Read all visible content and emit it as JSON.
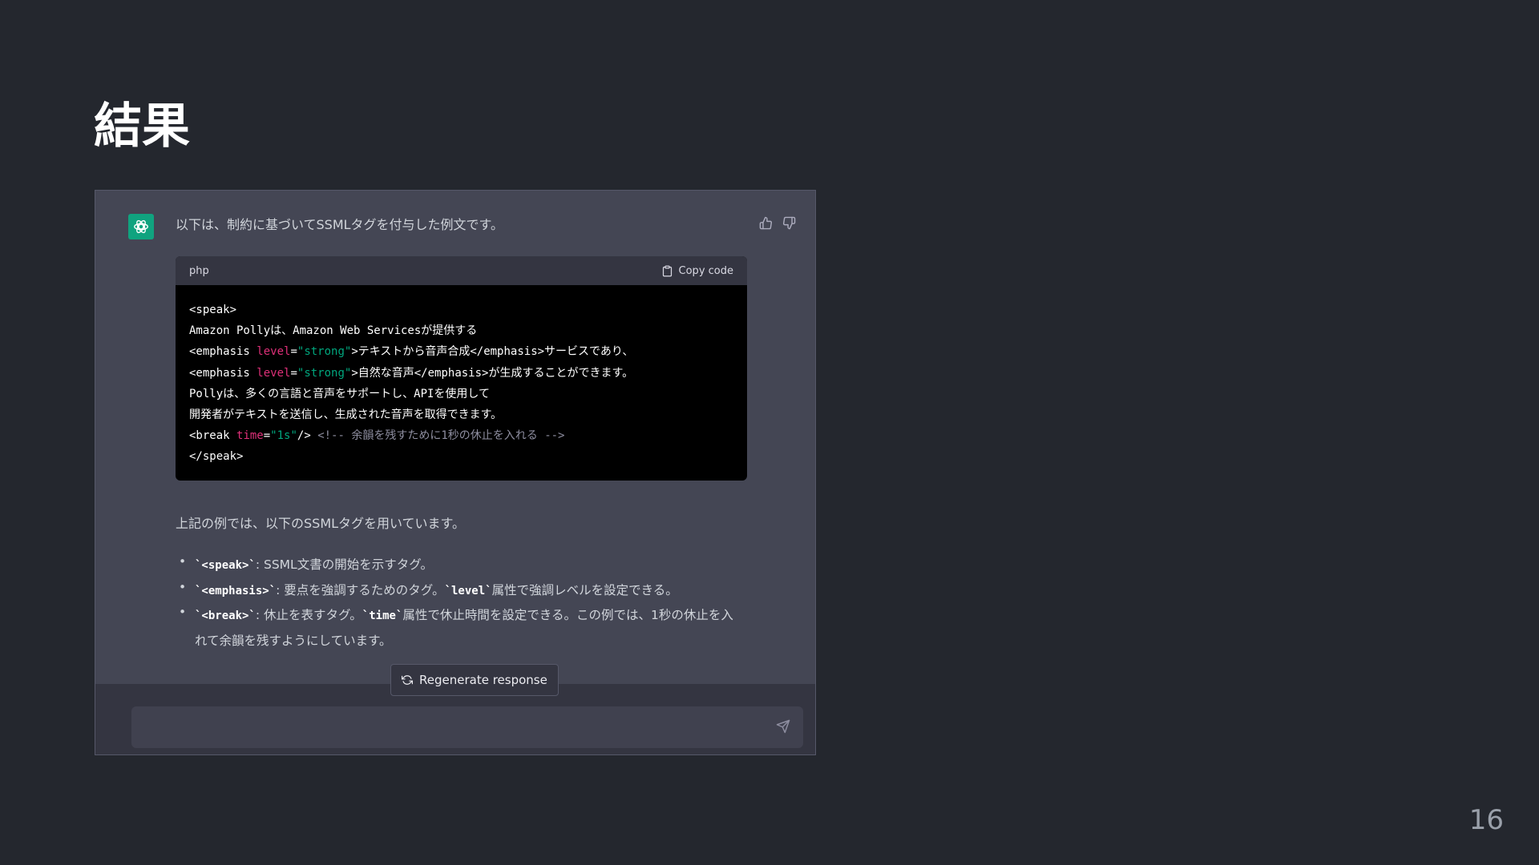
{
  "slide": {
    "title": "結果",
    "page_number": "16"
  },
  "chat": {
    "intro": "以下は、制約に基づいてSSMLタグを付与した例文です。",
    "code_block": {
      "language": "php",
      "copy_label": "Copy code",
      "lines": [
        {
          "text": "<speak>"
        },
        {
          "text": "Amazon Pollyは、Amazon Web Servicesが提供する"
        },
        {
          "pre": "<emphasis ",
          "attr": "level",
          "eq": "=",
          "str": "\"strong\"",
          "post": ">テキストから音声合成</emphasis>サービスであり、"
        },
        {
          "pre": "<emphasis ",
          "attr": "level",
          "eq": "=",
          "str": "\"strong\"",
          "post": ">自然な音声</emphasis>が生成することができます。"
        },
        {
          "text": "Pollyは、多くの言語と音声をサポートし、APIを使用して"
        },
        {
          "text": "開発者がテキストを送信し、生成された音声を取得できます。"
        },
        {
          "pre": "<break ",
          "attr": "time",
          "eq": "=",
          "str": "\"1s\"",
          "post": "/> ",
          "comment": "<!-- 余韻を残すために1秒の休止を入れる -->"
        },
        {
          "text": "</speak>"
        }
      ]
    },
    "summary": "上記の例では、以下のSSMLタグを用いています。",
    "bullets": [
      {
        "code": "`<speak>`",
        "text": ": SSML文書の開始を示すタグ。"
      },
      {
        "code": "`<emphasis>`",
        "text": ": 要点を強調するためのタグ。",
        "code2": "`level`",
        "text2": "属性で強調レベルを設定できる。"
      },
      {
        "code": "`<break>`",
        "text": ": 休止を表すタグ。",
        "code2": "`time`",
        "text2": "属性で休止時間を設定できる。この例では、1秒の休止を入れて余韻を残すようにしています。"
      }
    ],
    "regenerate_label": "Regenerate response",
    "input_value": "",
    "input_placeholder": ""
  },
  "colors": {
    "background": "#24272e",
    "panel": "#444654",
    "footer": "#343541",
    "input": "#40414f",
    "avatar": "#10a37f",
    "code_bg": "#000000",
    "code_attr": "#df3079",
    "code_string": "#00a67d",
    "code_comment": "#8e8ea0"
  },
  "icons": {
    "avatar": "openai-logo-icon",
    "like": "thumbs-up-icon",
    "dislike": "thumbs-down-icon",
    "copy": "clipboard-icon",
    "regenerate": "refresh-icon",
    "send": "send-icon"
  }
}
